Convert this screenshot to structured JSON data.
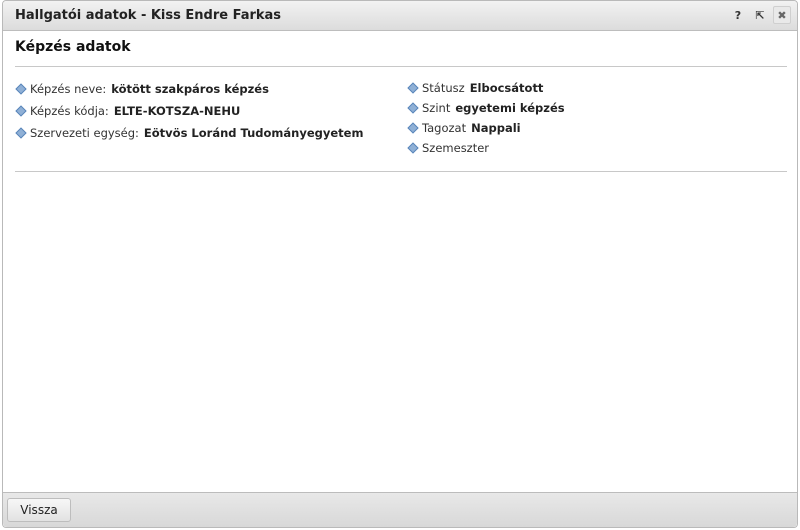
{
  "window": {
    "title": "Hallgatói adatok - Kiss Endre Farkas",
    "help_glyph": "?",
    "popout_glyph": "⇱",
    "close_glyph": "✖"
  },
  "section": {
    "title": "Képzés adatok"
  },
  "left_fields": [
    {
      "label": "Képzés neve:",
      "value": "kötött szakpáros képzés"
    },
    {
      "label": "Képzés kódja:",
      "value": "ELTE-KOTSZA-NEHU"
    },
    {
      "label": "Szervezeti egység:",
      "value": "Eötvös Loránd Tudományegyetem"
    }
  ],
  "right_fields": [
    {
      "label": "Státusz",
      "value": "Elbocsátott"
    },
    {
      "label": "Szint",
      "value": "egyetemi képzés"
    },
    {
      "label": "Tagozat",
      "value": "Nappali"
    },
    {
      "label": "Szemeszter",
      "value": ""
    }
  ],
  "footer": {
    "back_label": "Vissza"
  }
}
